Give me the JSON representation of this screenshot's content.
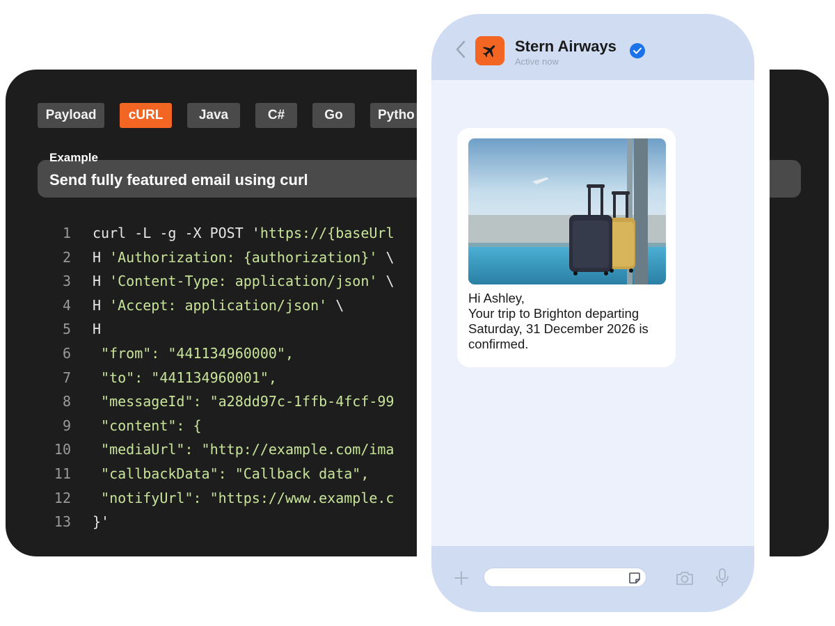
{
  "code_panel": {
    "tabs": [
      {
        "label": "Payload",
        "active": false
      },
      {
        "label": "cURL",
        "active": true
      },
      {
        "label": "Java",
        "active": false
      },
      {
        "label": "C#",
        "active": false
      },
      {
        "label": "Go",
        "active": false
      },
      {
        "label": "Pytho",
        "active": false
      }
    ],
    "example_label": "Example",
    "example_title": "Send fully featured email using curl",
    "code_lines": [
      {
        "n": "1",
        "parts": [
          {
            "t": "curl -L -g -X POST '",
            "s": "plain"
          },
          {
            "t": "https://{baseUrl",
            "s": "str"
          }
        ]
      },
      {
        "n": "2",
        "parts": [
          {
            "t": "H ",
            "s": "plain"
          },
          {
            "t": "'Authorization: {authorization}'",
            "s": "str"
          },
          {
            "t": " \\",
            "s": "plain"
          }
        ]
      },
      {
        "n": "3",
        "parts": [
          {
            "t": "H ",
            "s": "plain"
          },
          {
            "t": "'Content-Type: application/json'",
            "s": "str"
          },
          {
            "t": " \\",
            "s": "plain"
          }
        ]
      },
      {
        "n": "4",
        "parts": [
          {
            "t": "H ",
            "s": "plain"
          },
          {
            "t": "'Accept: application/json'",
            "s": "str"
          },
          {
            "t": " \\",
            "s": "plain"
          }
        ]
      },
      {
        "n": "5",
        "parts": [
          {
            "t": "H",
            "s": "plain"
          }
        ]
      },
      {
        "n": "6",
        "parts": [
          {
            "t": " \"from\": \"441134960000\",",
            "s": "str"
          }
        ]
      },
      {
        "n": "7",
        "parts": [
          {
            "t": " \"to\": \"441134960001\",",
            "s": "str"
          }
        ]
      },
      {
        "n": "8",
        "parts": [
          {
            "t": " \"messageId\": \"a28dd97c-1ffb-4fcf-99",
            "s": "str"
          }
        ]
      },
      {
        "n": "9",
        "parts": [
          {
            "t": " \"content\": {",
            "s": "str"
          }
        ]
      },
      {
        "n": "10",
        "parts": [
          {
            "t": " \"mediaUrl\": \"http://example.com/ima",
            "s": "str"
          }
        ]
      },
      {
        "n": "11",
        "parts": [
          {
            "t": " \"callbackData\": \"Callback data\",",
            "s": "str"
          }
        ]
      },
      {
        "n": "12",
        "parts": [
          {
            "t": " \"notifyUrl\": \"https://www.example.c",
            "s": "str"
          }
        ]
      },
      {
        "n": "13",
        "parts": [
          {
            "t": "}'",
            "s": "plain"
          }
        ]
      }
    ],
    "colors": {
      "panel_bg": "#1d1d1d",
      "tab_bg": "#4a4a4a",
      "accent": "#f26522",
      "string": "#c8e59a"
    }
  },
  "phone": {
    "header": {
      "contact_name": "Stern Airways",
      "status": "Active now",
      "logo_icon": "airplane-icon",
      "verified": true
    },
    "message": {
      "image_alt": "Suitcases at airport window with plane taking off",
      "lines": [
        "Hi Ashley,",
        "Your trip to Brighton departing",
        "Saturday, 31 December 2026 is",
        "confirmed."
      ]
    },
    "composer": {
      "placeholder": "",
      "icons": [
        "plus-icon",
        "sticker-icon",
        "camera-icon",
        "microphone-icon"
      ]
    },
    "colors": {
      "header_bg": "#cfdcf2",
      "chat_bg": "#ecf1fb",
      "verified": "#1a73e8"
    }
  }
}
